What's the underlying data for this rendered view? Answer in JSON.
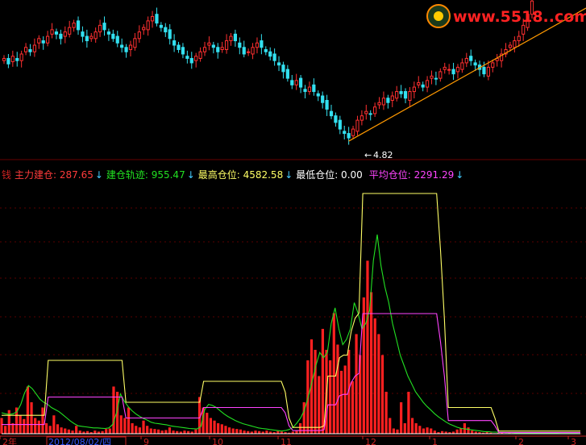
{
  "watermark": {
    "site": "www.5518..com",
    "color": "#ff2222"
  },
  "price_panel": {
    "low_label": "4.82",
    "colors": {
      "up": "#ff3030",
      "down": "#33e0f0",
      "trendline": "#ff9900"
    }
  },
  "indicator_header": {
    "prefix": "钱",
    "items": [
      {
        "label": "主力建仓:",
        "value": "287.65",
        "color": "#ff3b3b"
      },
      {
        "label": "建仓轨迹:",
        "value": "955.47",
        "color": "#22e022"
      },
      {
        "label": "最高仓位:",
        "value": "4582.58",
        "color": "#ffff66"
      },
      {
        "label": "最低仓位:",
        "value": "0.00",
        "color": "#ffffff"
      },
      {
        "label": "平均仓位:",
        "value": "2291.29",
        "color": "#ff44ff"
      }
    ],
    "arrow": "↓",
    "arrow_color": "#44ccff"
  },
  "axis": {
    "date_box": "2012/08/02/四",
    "month_labels": [
      "2年",
      "9",
      "10",
      "11",
      "12",
      "1",
      "2",
      "3"
    ],
    "colors": {
      "axis": "#cc2222",
      "text": "#cc2222"
    }
  },
  "chart_data": [
    {
      "type": "line",
      "panel": "price",
      "annotations": [
        "4.82"
      ],
      "low_value": 4.82,
      "series": [
        {
          "kind": "candlestick",
          "close": [
            5.6,
            5.55,
            5.62,
            5.58,
            5.64,
            5.7,
            5.66,
            5.72,
            5.78,
            5.74,
            5.8,
            5.86,
            5.82,
            5.78,
            5.84,
            5.88,
            5.92,
            5.86,
            5.8,
            5.76,
            5.8,
            5.84,
            5.9,
            5.86,
            5.82,
            5.78,
            5.74,
            5.7,
            5.66,
            5.72,
            5.78,
            5.84,
            5.88,
            5.94,
            5.98,
            5.92,
            5.88,
            5.84,
            5.78,
            5.72,
            5.68,
            5.64,
            5.6,
            5.56,
            5.62,
            5.66,
            5.7,
            5.74,
            5.7,
            5.66,
            5.7,
            5.76,
            5.8,
            5.76,
            5.7,
            5.64,
            5.66,
            5.7,
            5.74,
            5.7,
            5.66,
            5.62,
            5.58,
            5.54,
            5.48,
            5.42,
            5.36,
            5.4,
            5.34,
            5.3,
            5.34,
            5.3,
            5.26,
            5.2,
            5.14,
            5.08,
            5.02,
            4.96,
            4.92,
            4.88,
            4.96,
            5.04,
            5.08,
            5.12,
            5.1,
            5.16,
            5.2,
            5.24,
            5.2,
            5.26,
            5.3,
            5.28,
            5.24,
            5.3,
            5.34,
            5.38,
            5.34,
            5.4,
            5.44,
            5.42,
            5.48,
            5.52,
            5.5,
            5.46,
            5.52,
            5.56,
            5.6,
            5.58,
            5.54,
            5.5,
            5.46,
            5.52,
            5.56,
            5.6,
            5.64,
            5.68,
            5.72,
            5.76,
            5.8,
            5.9,
            6.0,
            6.12
          ]
        }
      ]
    },
    {
      "type": "line",
      "panel": "indicator",
      "ylim": [
        0,
        4582.58
      ],
      "series": [
        {
          "name": "主力建仓",
          "kind": "bar",
          "color": "#ff2020",
          "values": [
            300,
            150,
            450,
            200,
            500,
            350,
            280,
            900,
            600,
            300,
            250,
            500,
            200,
            150,
            350,
            180,
            120,
            100,
            80,
            60,
            150,
            60,
            40,
            50,
            30,
            60,
            40,
            50,
            90,
            100,
            900,
            800,
            350,
            300,
            500,
            200,
            150,
            120,
            250,
            150,
            100,
            90,
            80,
            60,
            70,
            120,
            60,
            50,
            40,
            60,
            50,
            40,
            80,
            700,
            500,
            400,
            300,
            250,
            200,
            180,
            150,
            120,
            100,
            90,
            80,
            60,
            50,
            40,
            60,
            50,
            40,
            60,
            40,
            30,
            50,
            40,
            30,
            20,
            40,
            60,
            200,
            600,
            1400,
            1800,
            1600,
            1100,
            2000,
            1600,
            1400,
            2300,
            1700,
            1200,
            1300,
            1600,
            1000,
            1900,
            1500,
            2600,
            3300,
            2700,
            2200,
            1900,
            1500,
            800,
            300,
            100,
            80,
            600,
            200,
            800,
            300,
            200,
            150,
            100,
            120,
            100,
            60,
            30,
            50,
            40,
            30,
            40,
            80,
            100,
            200,
            120,
            60,
            40,
            30,
            20,
            30,
            20,
            10,
            15,
            20,
            10,
            15,
            10,
            12,
            8,
            6,
            8,
            10,
            8,
            6,
            5,
            8,
            6,
            5,
            4,
            6,
            4,
            3,
            2,
            3,
            2
          ]
        },
        {
          "name": "建仓轨迹",
          "kind": "line",
          "color": "#22e022",
          "values": [
            400,
            380,
            370,
            380,
            420,
            560,
            780,
            920,
            860,
            760,
            660,
            600,
            560,
            500,
            460,
            420,
            360,
            300,
            240,
            190,
            150,
            140,
            130,
            120,
            110,
            110,
            105,
            100,
            110,
            180,
            400,
            760,
            620,
            520,
            440,
            380,
            330,
            290,
            260,
            220,
            200,
            190,
            180,
            170,
            150,
            140,
            130,
            120,
            110,
            100,
            95,
            90,
            140,
            460,
            560,
            540,
            500,
            440,
            380,
            330,
            290,
            250,
            220,
            190,
            170,
            150,
            130,
            110,
            100,
            90,
            80,
            70,
            60,
            50,
            60,
            80,
            120,
            200,
            300,
            450,
            700,
            1000,
            1300,
            1550,
            1450,
            1550,
            2100,
            2400,
            2000,
            1700,
            1800,
            2000,
            2500,
            2300,
            2000,
            2100,
            2350,
            3300,
            3800,
            3200,
            2800,
            2500,
            2100,
            1800,
            1500,
            1300,
            1100,
            950,
            800,
            700,
            600,
            520,
            450,
            380,
            320,
            270,
            220,
            180,
            150,
            120,
            100,
            90,
            80,
            70,
            60,
            50,
            40,
            40,
            30,
            30,
            25,
            25,
            20,
            20,
            15,
            15,
            12,
            12,
            10,
            10,
            10,
            8,
            8,
            8,
            6,
            6,
            5,
            5,
            5,
            4,
            4,
            3
          ]
        },
        {
          "name": "最高仓位",
          "kind": "line",
          "color": "#ffff66",
          "values": [
            350,
            350,
            350,
            350,
            350,
            350,
            350,
            350,
            350,
            350,
            350,
            350,
            1400,
            1400,
            1400,
            1400,
            1400,
            1400,
            1400,
            1400,
            1400,
            1400,
            1400,
            1400,
            1400,
            1400,
            1400,
            1400,
            1400,
            1400,
            1400,
            1400,
            600,
            600,
            600,
            600,
            600,
            600,
            600,
            600,
            600,
            600,
            600,
            600,
            600,
            600,
            600,
            600,
            600,
            600,
            600,
            600,
            1000,
            1000,
            1000,
            1000,
            1000,
            1000,
            1000,
            1000,
            1000,
            1000,
            1000,
            1000,
            1000,
            1000,
            1000,
            1000,
            1000,
            1000,
            1000,
            1000,
            1000,
            800,
            300,
            120,
            120,
            120,
            120,
            120,
            120,
            120,
            120,
            150,
            1100,
            1100,
            1100,
            1450,
            1500,
            1500,
            1950,
            2200,
            2300,
            4582,
            4582,
            4582,
            4582,
            4582,
            4582,
            4582,
            4582,
            4582,
            4582,
            4582,
            4582,
            4582,
            4582,
            4582,
            4582,
            4582,
            4582,
            4582,
            4582,
            3500,
            2200,
            500,
            500,
            500,
            500,
            500,
            500,
            500,
            500,
            500,
            500,
            500,
            500,
            300,
            50,
            50,
            50,
            50,
            50,
            50,
            50,
            50,
            50,
            50,
            50,
            50,
            50,
            50,
            50,
            50,
            50,
            50,
            50,
            50,
            50,
            50
          ]
        },
        {
          "name": "最低仓位",
          "kind": "line",
          "color": "#ffffff",
          "values": [
            0,
            0,
            0,
            0,
            0,
            0,
            0,
            0,
            0,
            0,
            0,
            0,
            0,
            0,
            0,
            0,
            0,
            0,
            0,
            0,
            0,
            0,
            0,
            0,
            0,
            0,
            0,
            0,
            0,
            0,
            0,
            0,
            0,
            0,
            0,
            0,
            0,
            0,
            0,
            0,
            0,
            0,
            0,
            0,
            0,
            0,
            0,
            0,
            0,
            0,
            0,
            0,
            0,
            0,
            0,
            0,
            0,
            0,
            0,
            0,
            0,
            0,
            0,
            0,
            0,
            0,
            0,
            0,
            0,
            0,
            0,
            0,
            0,
            0,
            0,
            0,
            0,
            0,
            0,
            0,
            0,
            0,
            0,
            0,
            0,
            0,
            0,
            0,
            0,
            0,
            0,
            0,
            0,
            0,
            0,
            0,
            0,
            0,
            0,
            0,
            0,
            0,
            0,
            0,
            0,
            0,
            0,
            0,
            0,
            0,
            0,
            0,
            0,
            0,
            0,
            0,
            0,
            0,
            0,
            0,
            0,
            0,
            0,
            0,
            0,
            0,
            0,
            0,
            0,
            0,
            0,
            0,
            0,
            0,
            0,
            0,
            0,
            0,
            0,
            0,
            0,
            0,
            0,
            0,
            0,
            0,
            0,
            0,
            0,
            0,
            0
          ]
        },
        {
          "name": "平均仓位",
          "kind": "line",
          "color": "#ff44ff",
          "values": [
            175,
            175,
            175,
            175,
            175,
            175,
            175,
            175,
            175,
            175,
            175,
            175,
            700,
            700,
            700,
            700,
            700,
            700,
            700,
            700,
            700,
            700,
            700,
            700,
            700,
            700,
            700,
            700,
            700,
            700,
            700,
            700,
            300,
            300,
            300,
            300,
            300,
            300,
            300,
            300,
            300,
            300,
            300,
            300,
            300,
            300,
            300,
            300,
            300,
            300,
            300,
            300,
            500,
            500,
            500,
            500,
            500,
            500,
            500,
            500,
            500,
            500,
            500,
            500,
            500,
            500,
            500,
            500,
            500,
            500,
            500,
            500,
            500,
            400,
            150,
            60,
            60,
            60,
            60,
            60,
            60,
            60,
            60,
            75,
            550,
            550,
            550,
            725,
            750,
            750,
            975,
            1100,
            1150,
            2291,
            2291,
            2291,
            2291,
            2291,
            2291,
            2291,
            2291,
            2291,
            2291,
            2291,
            2291,
            2291,
            2291,
            2291,
            2291,
            2291,
            2291,
            2291,
            2291,
            1750,
            1100,
            250,
            250,
            250,
            250,
            250,
            250,
            250,
            250,
            250,
            250,
            250,
            250,
            150,
            25,
            25,
            25,
            25,
            25,
            25,
            25,
            25,
            25,
            25,
            25,
            25,
            25,
            25,
            25,
            25,
            25,
            25,
            25,
            25,
            25,
            25
          ]
        }
      ]
    }
  ]
}
